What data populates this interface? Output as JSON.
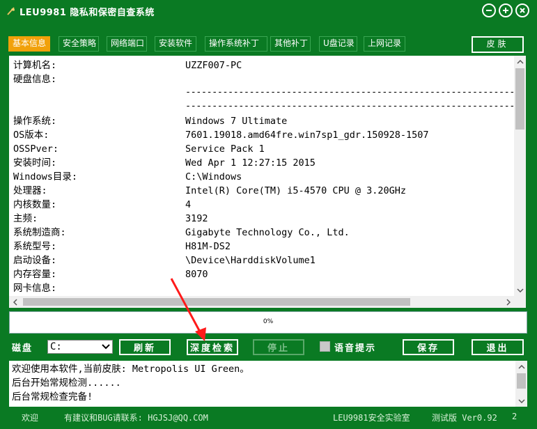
{
  "window": {
    "title": "LEU9981 隐私和保密自查系统"
  },
  "tabs": [
    {
      "label": "基本信息"
    },
    {
      "label": "安全策略"
    },
    {
      "label": "网络端口"
    },
    {
      "label": "安装软件"
    },
    {
      "label": "操作系统补丁"
    },
    {
      "label": "其他补丁"
    },
    {
      "label": "U盘记录"
    },
    {
      "label": "上网记录"
    }
  ],
  "skin_button": "皮肤",
  "info": {
    "rows": [
      {
        "k": "计算机名:",
        "v": "UZZF007-PC"
      },
      {
        "k": "硬盘信息:",
        "v": ""
      },
      {
        "k": "操作系统:",
        "v": "Windows 7 Ultimate"
      },
      {
        "k": "OS版本:",
        "v": "7601.19018.amd64fre.win7sp1_gdr.150928-1507"
      },
      {
        "k": "OSSPver:",
        "v": "Service Pack 1"
      },
      {
        "k": "安装时间:",
        "v": "Wed Apr  1 12:27:15 2015"
      },
      {
        "k": "Windows目录:",
        "v": "C:\\Windows"
      },
      {
        "k": "处理器:",
        "v": "Intel(R) Core(TM) i5-4570 CPU @ 3.20GHz"
      },
      {
        "k": "内核数量:",
        "v": "4"
      },
      {
        "k": "主频:",
        "v": "3192"
      },
      {
        "k": "系统制造商:",
        "v": "Gigabyte Technology Co., Ltd."
      },
      {
        "k": "系统型号:",
        "v": "H81M-DS2"
      },
      {
        "k": "启动设备:",
        "v": "\\Device\\HarddiskVolume1"
      },
      {
        "k": "内存容量:",
        "v": "8070"
      },
      {
        "k": "网卡信息:",
        "v": ""
      }
    ],
    "dashes": "------------------------------------------------------------------------------------------------"
  },
  "progress": {
    "text": "0%",
    "value": 0
  },
  "controls": {
    "disk_label": "磁盘",
    "disk_value": "C:",
    "refresh": "刷新",
    "deep_scan": "深度检索",
    "stop": "停止",
    "voice_label": "语音提示",
    "save": "保存",
    "exit": "退出"
  },
  "log": [
    "欢迎使用本软件,当前皮肤: Metropolis UI Green。",
    "后台开始常规检测......",
    "后台常规检查完备!"
  ],
  "status": {
    "welcome": "欢迎",
    "contact": "有建议和BUG请联系: HGJSJ@QQ.COM",
    "lab": "LEU9981安全实验室",
    "version": "测试版 Ver0.92",
    "extra": "2"
  },
  "colors": {
    "bg": "#0a7a23",
    "active_tab": "#f1a10a",
    "annotation": "#ff1a1a"
  }
}
